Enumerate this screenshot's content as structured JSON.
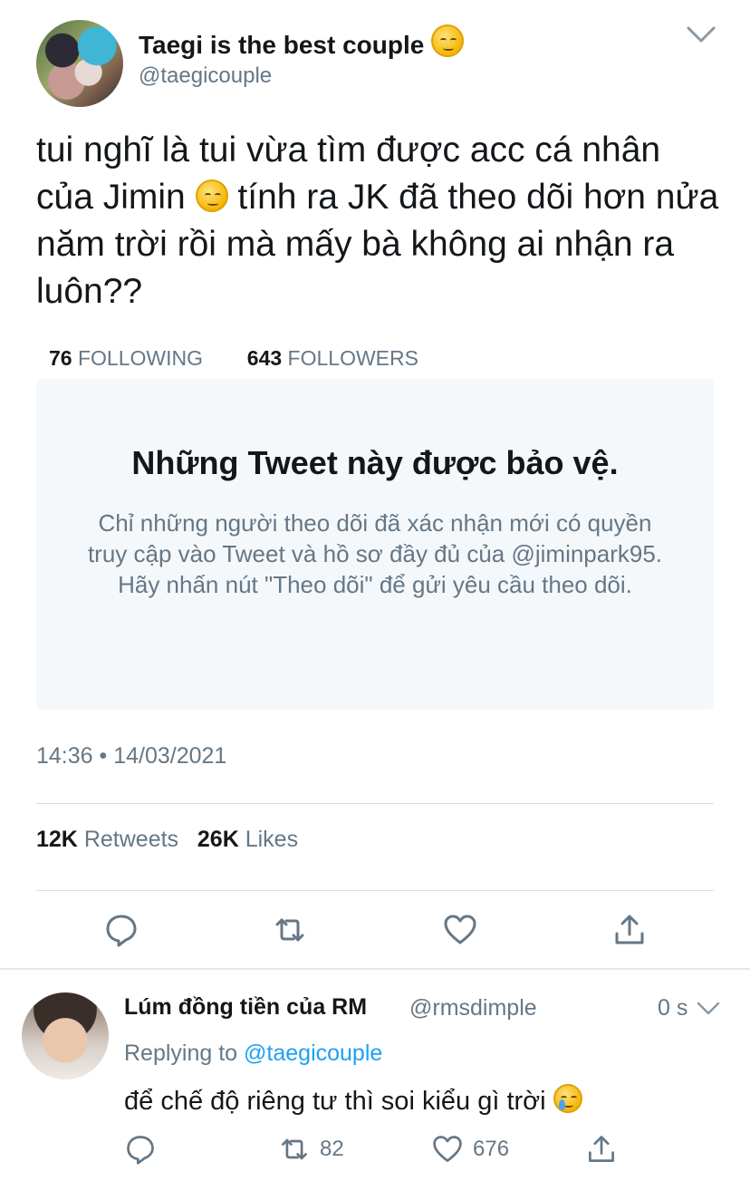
{
  "tweet": {
    "display_name": "Taegi is the best couple",
    "name_emoji": "relieved-face",
    "handle": "@taegicouple",
    "text_part1": "tui nghĩ là tui vừa tìm được acc cá nhân của Jimin",
    "text_emoji": "relieved-face",
    "text_part2": "tính ra JK đã theo dõi hơn nửa năm trời rồi mà mấy bà không ai nhận ra luôn??",
    "timestamp": "14:36 • 14/03/2021",
    "retweets_count": "12K",
    "retweets_label": "Retweets",
    "likes_count": "26K",
    "likes_label": "Likes"
  },
  "profile_card": {
    "following_count": "76",
    "following_label": "FOLLOWING",
    "followers_count": "643",
    "followers_label": "FOLLOWERS",
    "protected_title": "Những Tweet này được bảo vệ.",
    "protected_body": "Chỉ những người theo dõi đã xác nhận mới có quyền truy cập vào Tweet và hồ sơ đầy đủ của @jiminpark95. Hãy nhấn nút \"Theo dõi\" để gửi yêu cầu theo dõi."
  },
  "reply": {
    "display_name": "Lúm đồng tiền của RM",
    "handle": "@rmsdimple",
    "time": "0 s",
    "replying_label": "Replying to",
    "replying_handle": "@taegicouple",
    "text": "để chế độ riêng tư thì soi kiểu gì trời",
    "text_emoji": "crying-face",
    "retweet_count": "82",
    "like_count": "676"
  },
  "colors": {
    "text": "#14171a",
    "secondary": "#657786",
    "link": "#1da1f2",
    "card_bg": "#f5f8fa",
    "divider": "#d6dde3"
  }
}
